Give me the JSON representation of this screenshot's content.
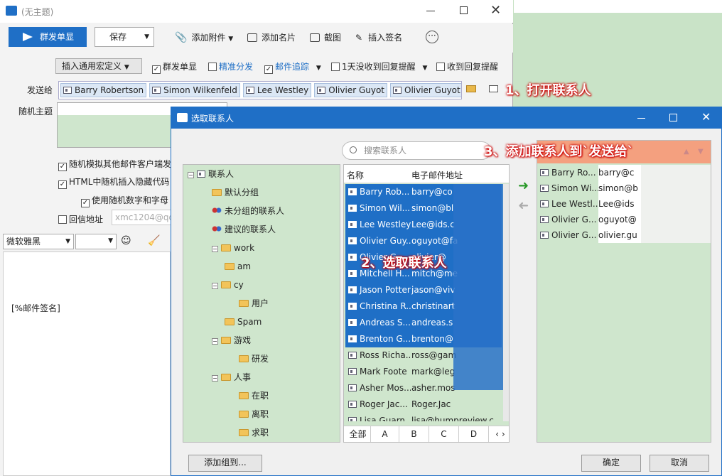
{
  "compose": {
    "title": "(无主题)",
    "toolbar": {
      "send": "群发单显",
      "save": "保存",
      "attach": "添加附件",
      "card": "添加名片",
      "screenshot": "截图",
      "signature": "插入签名"
    },
    "options": {
      "macro": "插入通用宏定义",
      "mass_single": "群发单显",
      "precise": "精准分发",
      "track": "邮件追踪",
      "no_reply": "1天没收到回复提醒",
      "got_reply": "收到回复提醒"
    },
    "to_label": "发送给",
    "recipients": [
      "Barry Robertson",
      "Simon Wilkenfeld",
      "Lee Westley",
      "Olivier Guyot",
      "Olivier Guyot"
    ],
    "subject_label": "随机主题",
    "check1": "随机模拟其他邮件客户端发",
    "check2": "HTML中随机插入隐藏代码",
    "check3": "使用随机数字和字母",
    "reply_label": "回信地址",
    "reply_placeholder": "xmc1204@qq",
    "font": "微软雅黑",
    "body_text": "[%邮件签名]"
  },
  "dialog": {
    "title": "选取联系人",
    "search_placeholder": "搜索联系人",
    "tree": [
      {
        "label": "联系人",
        "icon": "book"
      },
      {
        "label": "默认分组",
        "icon": "folder"
      },
      {
        "label": "未分组的联系人",
        "icon": "people"
      },
      {
        "label": "建议的联系人",
        "icon": "people"
      },
      {
        "label": "work",
        "icon": "folder"
      },
      {
        "label": "am",
        "icon": "folder"
      },
      {
        "label": "cy",
        "icon": "folder"
      },
      {
        "label": "用户",
        "icon": "folder"
      },
      {
        "label": "Spam",
        "icon": "folder"
      },
      {
        "label": "游戏",
        "icon": "folder"
      },
      {
        "label": "研发",
        "icon": "folder"
      },
      {
        "label": "人事",
        "icon": "folder"
      },
      {
        "label": "在职",
        "icon": "folder"
      },
      {
        "label": "离职",
        "icon": "folder"
      },
      {
        "label": "求职",
        "icon": "folder"
      }
    ],
    "list_headers": {
      "name": "名称",
      "email": "电子邮件地址"
    },
    "contacts": [
      {
        "name": "Barry Rob...",
        "email": "barry@co"
      },
      {
        "name": "Simon Wil...",
        "email": "simon@bl"
      },
      {
        "name": "Lee Westley",
        "email": "Lee@ids.c"
      },
      {
        "name": "Olivier Guy...",
        "email": "oguyot@fa"
      },
      {
        "name": "Olivier G...",
        "email": "olivier@"
      },
      {
        "name": "Mitchell H...",
        "email": "mitch@me"
      },
      {
        "name": "Jason Potter",
        "email": "jason@viv"
      },
      {
        "name": "Christina R...",
        "email": "christinart"
      },
      {
        "name": "Andreas S...",
        "email": "andreas.s"
      },
      {
        "name": "Brenton G...",
        "email": "brenton@"
      },
      {
        "name": "Ross Richa...",
        "email": "ross@gam"
      },
      {
        "name": "Mark Foote",
        "email": "mark@leg"
      },
      {
        "name": "Asher Mos...",
        "email": "asher.mos"
      },
      {
        "name": "Roger Jac...",
        "email": "Roger.Jac"
      },
      {
        "name": "Lisa Guarn...",
        "email": "lisa@humpreview.c"
      }
    ],
    "tabs": [
      "全部",
      "A",
      "B",
      "C",
      "D"
    ],
    "selected": [
      {
        "name": "Barry Ro...",
        "email": "barry@c"
      },
      {
        "name": "Simon Wi...",
        "email": "simon@b"
      },
      {
        "name": "Lee Westl...",
        "email": "Lee@ids"
      },
      {
        "name": "Olivier G...",
        "email": "oguyot@"
      },
      {
        "name": "Olivier G...",
        "email": "olivier.gu"
      }
    ],
    "add_group": "添加组到...",
    "ok": "确定",
    "cancel": "取消"
  },
  "annotations": {
    "a1": "1、打开联系人",
    "a2": "2、选取联系人",
    "a3": "3、添加联系人到`发送给`"
  },
  "colors": {
    "accent": "#1f6fc6",
    "green": "#cfe6cd",
    "annot_bg": "#f4a07f"
  }
}
